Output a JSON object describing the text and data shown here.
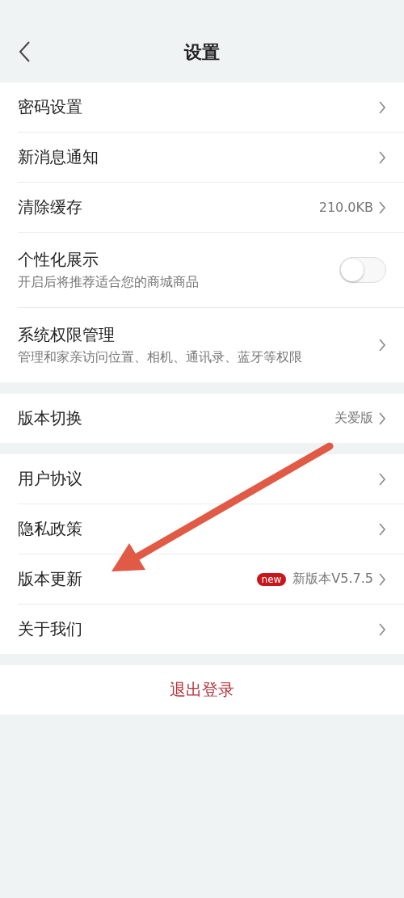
{
  "header": {
    "title": "设置"
  },
  "sections": [
    {
      "rows": [
        {
          "kind": "link",
          "title": "密码设置"
        },
        {
          "kind": "link",
          "title": "新消息通知"
        },
        {
          "kind": "link",
          "title": "清除缓存",
          "value": "210.0KB"
        },
        {
          "kind": "toggle",
          "title": "个性化展示",
          "subtitle": "开启后将推荐适合您的商城商品",
          "on": false
        },
        {
          "kind": "link",
          "title": "系统权限管理",
          "subtitle": "管理和家亲访问位置、相机、通讯录、蓝牙等权限"
        }
      ]
    },
    {
      "rows": [
        {
          "kind": "link",
          "title": "版本切换",
          "value": "关爱版"
        }
      ]
    },
    {
      "rows": [
        {
          "kind": "link",
          "title": "用户协议"
        },
        {
          "kind": "link",
          "title": "隐私政策"
        },
        {
          "kind": "link",
          "title": "版本更新",
          "badge": "new",
          "value": "新版本V5.7.5"
        },
        {
          "kind": "link",
          "title": "关于我们"
        }
      ]
    }
  ],
  "logout": {
    "label": "退出登录"
  }
}
